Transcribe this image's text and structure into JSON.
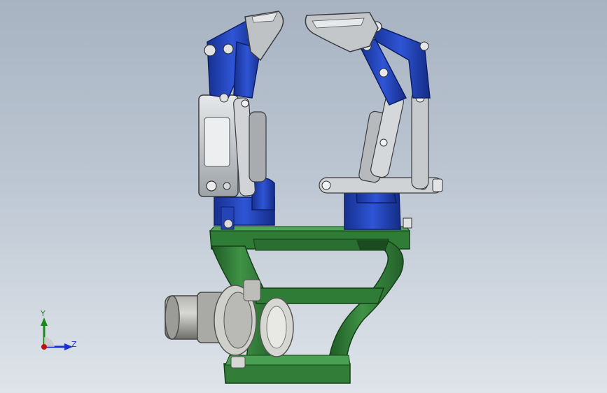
{
  "viewport": {
    "background_top": "#a8b3c2",
    "background_bottom": "#dfe4ea"
  },
  "model": {
    "parts": [
      "gripper-base-frame",
      "rotary-actuator",
      "left-finger-linkage",
      "right-finger-linkage",
      "left-jaw",
      "right-jaw"
    ],
    "colors": {
      "frame": "#2e7a35",
      "linkage": "#1f3fb8",
      "links": "#c9cccf",
      "actuator": "#8a8a8a"
    }
  },
  "triad": {
    "y_label": "Y",
    "z_label": "Z",
    "y_color": "#1a8a1a",
    "z_color": "#1c2fd0",
    "origin_color": "#c01010"
  }
}
